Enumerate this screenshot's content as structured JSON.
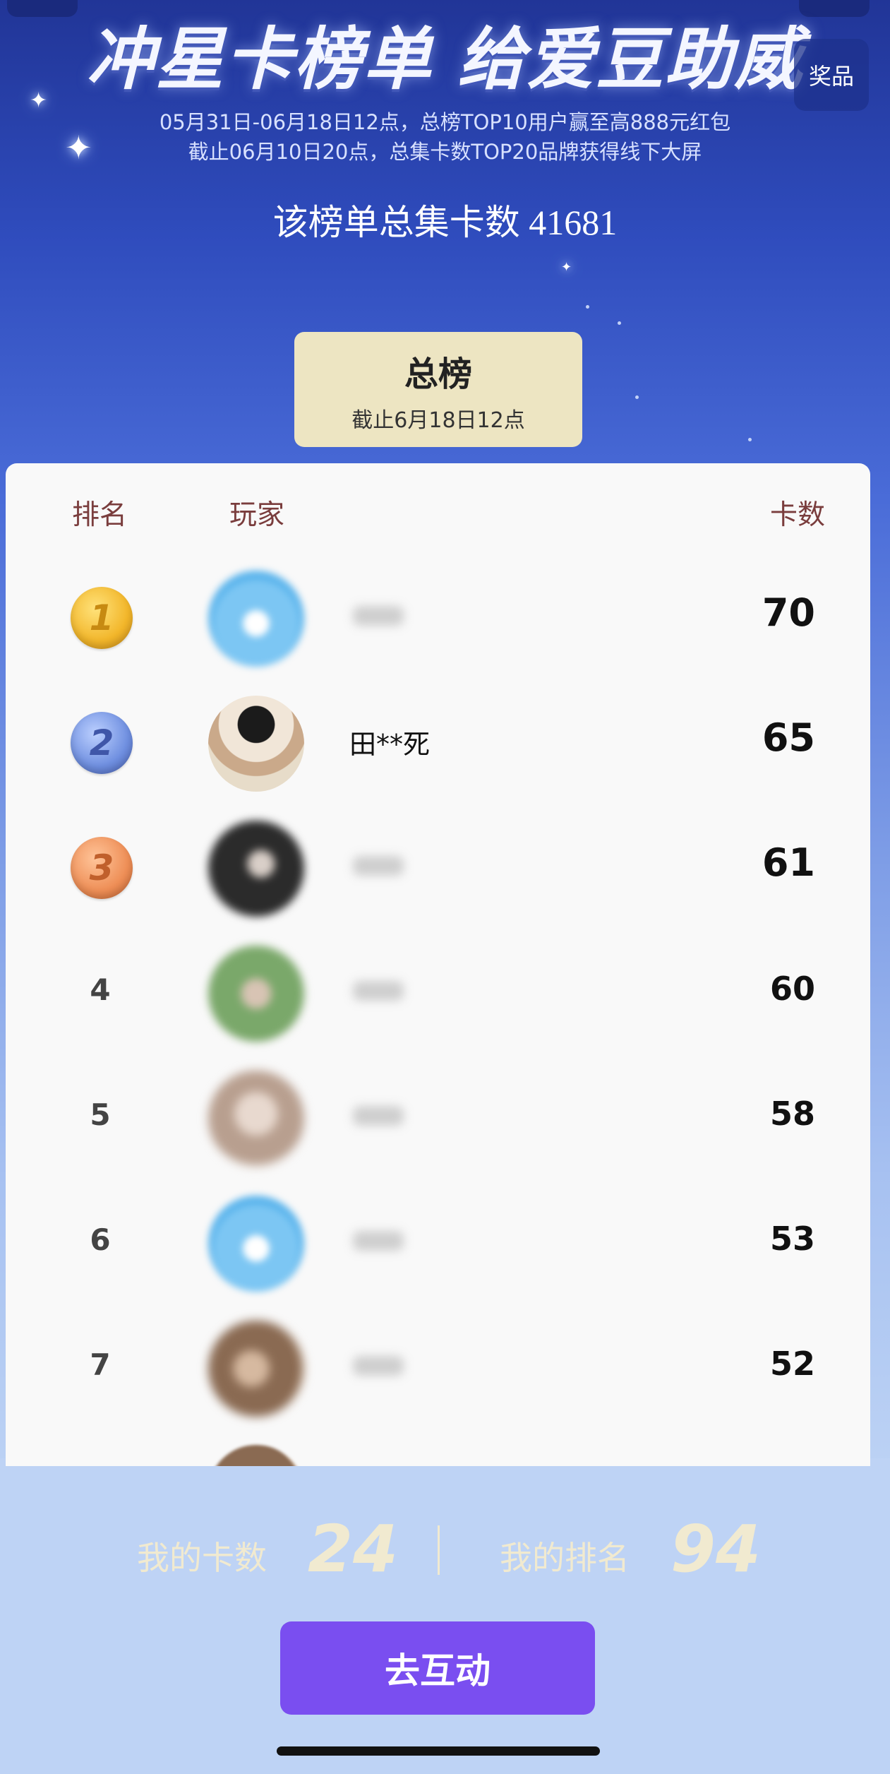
{
  "header": {
    "title": "冲星卡榜单  给爱豆助威",
    "subtitle_line1": "05月31日-06月18日12点，总榜TOP10用户赢至高888元红包",
    "subtitle_line2": "截止06月10日20点，总集卡数TOP20品牌获得线下大屏",
    "total_cards_text": "该榜单总集卡数 41681",
    "prize_button": "奖品"
  },
  "tab": {
    "title": "总榜",
    "subtitle": "截止6月18日12点"
  },
  "table": {
    "headers": {
      "rank": "排名",
      "player": "玩家",
      "cards": "卡数"
    },
    "rows": [
      {
        "rank": "1",
        "name": "",
        "cards": "70"
      },
      {
        "rank": "2",
        "name": "田**死",
        "cards": "65"
      },
      {
        "rank": "3",
        "name": "",
        "cards": "61"
      },
      {
        "rank": "4",
        "name": "",
        "cards": "60"
      },
      {
        "rank": "5",
        "name": "",
        "cards": "58"
      },
      {
        "rank": "6",
        "name": "",
        "cards": "53"
      },
      {
        "rank": "7",
        "name": "",
        "cards": "52"
      }
    ]
  },
  "my_stats": {
    "cards_label": "我的卡数",
    "cards_value": "24",
    "rank_label": "我的排名",
    "rank_value": "94"
  },
  "cta": {
    "label": "去互动"
  },
  "colors": {
    "accent_purple": "#7a4ef0",
    "tab_bg": "#ede5c2",
    "header_text": "#7a3d3d"
  }
}
